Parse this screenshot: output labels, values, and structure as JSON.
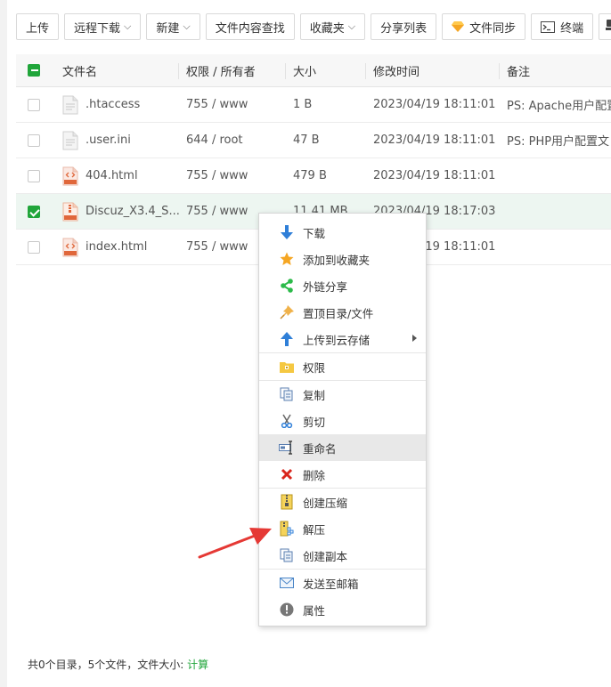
{
  "toolbar": {
    "upload": "上传",
    "remote_download": "远程下载",
    "new": "新建",
    "content_search": "文件内容查找",
    "favorites": "收藏夹",
    "share_list": "分享列表",
    "file_sync": "文件同步",
    "terminal": "终端"
  },
  "table": {
    "headers": {
      "name": "文件名",
      "perm": "权限 / 所有者",
      "size": "大小",
      "mtime": "修改时间",
      "note": "备注"
    },
    "rows": [
      {
        "name": ".htaccess",
        "perm": "755 / www",
        "size": "1 B",
        "mtime": "2023/04/19 18:11:01",
        "note": "PS: Apache用户配置",
        "icon": "text-file-icon",
        "checked": false
      },
      {
        "name": ".user.ini",
        "perm": "644 / root",
        "size": "47 B",
        "mtime": "2023/04/19 18:11:01",
        "note": "PS: PHP用户配置文",
        "icon": "text-file-icon",
        "checked": false
      },
      {
        "name": "404.html",
        "perm": "755 / www",
        "size": "479 B",
        "mtime": "2023/04/19 18:11:01",
        "note": "",
        "icon": "html-file-icon",
        "checked": false
      },
      {
        "name": "Discuz_X3.4_S...",
        "perm": "755 / www",
        "size": "11.41 MB",
        "mtime": "2023/04/19 18:17:03",
        "note": "",
        "icon": "zip-file-icon",
        "checked": true
      },
      {
        "name": "index.html",
        "perm": "755 / www",
        "size": "",
        "mtime": "2023/04/19 18:11:01",
        "note": "",
        "icon": "html-file-icon",
        "checked": false
      }
    ]
  },
  "footer": {
    "summary": "共0个目录，5个文件，文件大小: ",
    "calc": "计算"
  },
  "context_menu": {
    "items": [
      {
        "label": "下载",
        "icon": "download-icon"
      },
      {
        "label": "添加到收藏夹",
        "icon": "star-icon"
      },
      {
        "label": "外链分享",
        "icon": "share-icon"
      },
      {
        "label": "置顶目录/文件",
        "icon": "pin-icon"
      },
      {
        "label": "上传到云存储",
        "icon": "cloud-upload-icon"
      },
      {
        "label": "权限",
        "icon": "folder-lock-icon"
      },
      {
        "label": "复制",
        "icon": "copy-icon"
      },
      {
        "label": "剪切",
        "icon": "scissors-icon"
      },
      {
        "label": "重命名",
        "icon": "rename-icon"
      },
      {
        "label": "删除",
        "icon": "delete-icon"
      },
      {
        "label": "创建压缩",
        "icon": "compress-icon"
      },
      {
        "label": "解压",
        "icon": "extract-icon"
      },
      {
        "label": "创建副本",
        "icon": "duplicate-icon"
      },
      {
        "label": "发送至邮箱",
        "icon": "mail-icon"
      },
      {
        "label": "属性",
        "icon": "info-icon"
      }
    ]
  },
  "colors": {
    "accent_green": "#20a53a",
    "selected_row": "#edf6f1",
    "annotation_arrow": "#e53935"
  }
}
